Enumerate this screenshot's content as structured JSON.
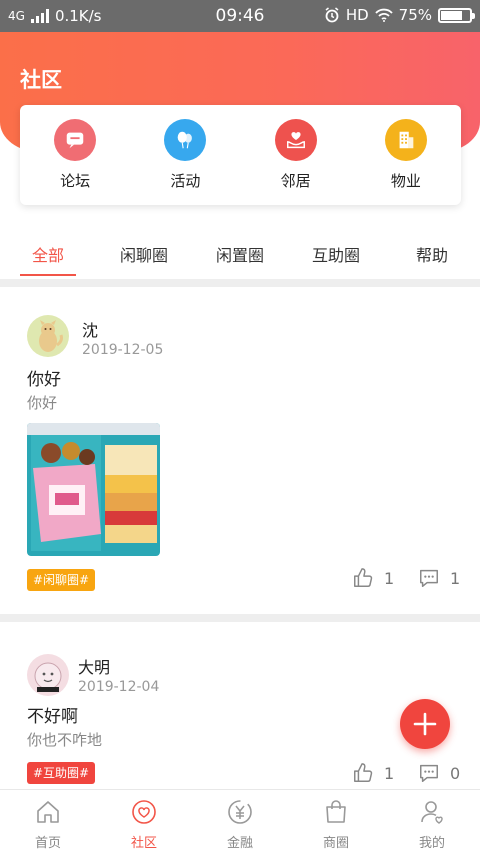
{
  "status_bar": {
    "network": "4G",
    "speed": "0.1K/s",
    "time": "09:46",
    "hd": "HD",
    "battery": "75%",
    "battery_level": 0.75
  },
  "header": {
    "title": "社区"
  },
  "quick_links": [
    {
      "label": "论坛",
      "icon": "chat-icon",
      "color": "#f06d73"
    },
    {
      "label": "活动",
      "icon": "balloon-icon",
      "color": "#37a8ee"
    },
    {
      "label": "邻居",
      "icon": "heart-hand-icon",
      "color": "#ee524e"
    },
    {
      "label": "物业",
      "icon": "building-icon",
      "color": "#f4b21b"
    }
  ],
  "tabs": [
    "全部",
    "闲聊圈",
    "闲置圈",
    "互助圈",
    "帮助"
  ],
  "active_tab": 0,
  "posts": [
    {
      "author": "沈",
      "date": "2019-12-05",
      "title": "你好",
      "body": "你好",
      "tag": "#闲聊圈#",
      "tag_color": "#f8a510",
      "likes": "1",
      "comments": "1"
    },
    {
      "author": "大明",
      "date": "2019-12-04",
      "title": "不好啊",
      "body": "你也不咋地",
      "tag": "#互助圈#",
      "tag_color": "#f0453e",
      "likes": "1",
      "comments": "0"
    }
  ],
  "bottom_nav": [
    {
      "label": "首页",
      "icon": "home-icon"
    },
    {
      "label": "社区",
      "icon": "community-icon"
    },
    {
      "label": "金融",
      "icon": "finance-icon"
    },
    {
      "label": "商圈",
      "icon": "shopping-bag-icon"
    },
    {
      "label": "我的",
      "icon": "profile-icon"
    }
  ],
  "active_nav": 1,
  "colors": {
    "accent": "#f25548",
    "header_start": "#fb6f49",
    "header_end": "#f8636a"
  }
}
